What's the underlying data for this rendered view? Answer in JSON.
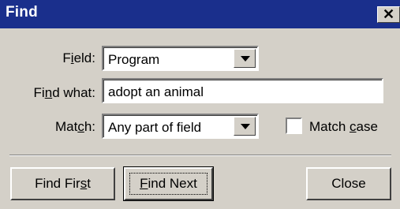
{
  "window": {
    "title": "Find",
    "close_glyph": "✕"
  },
  "form": {
    "field_label": "Field:",
    "field_value": "Program",
    "find_what_label": "Find what:",
    "find_what_value": "adopt an animal",
    "match_label": "Match:",
    "match_value": "Any part of field",
    "match_case_label": "Match case",
    "match_case_checked": false
  },
  "buttons": {
    "find_first": "Find First",
    "find_next": "Find Next",
    "close": "Close"
  },
  "colors": {
    "titlebar": "#1a2f8c",
    "face": "#d4d0c8"
  },
  "icons": {
    "close": "close-icon",
    "dropdown": "chevron-down-icon",
    "checkbox": "checkbox-icon"
  }
}
